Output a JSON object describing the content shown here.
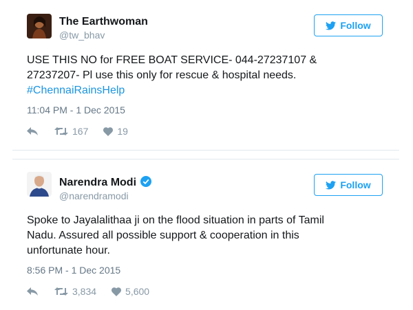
{
  "tweets": [
    {
      "name": "The Earthwoman",
      "handle": "@tw_bhav",
      "verified": false,
      "follow_label": "Follow",
      "text_lines": [
        "USE THIS NO for FREE BOAT SERVICE- 044-27237107 &",
        "27237207- Pl use this only for rescue & hospital needs."
      ],
      "hashtag": "#ChennaiRainsHelp",
      "timestamp": "11:04 PM - 1 Dec 2015",
      "retweets": "167",
      "likes": "19"
    },
    {
      "name": "Narendra Modi",
      "handle": "@narendramodi",
      "verified": true,
      "follow_label": "Follow",
      "text_lines": [
        "Spoke to Jayalalithaa ji on the flood situation in parts of Tamil",
        "Nadu. Assured all possible support & cooperation in this",
        "unfortunate hour."
      ],
      "timestamp": "8:56 PM - 1 Dec 2015",
      "retweets": "3,834",
      "likes": "5,600"
    }
  ],
  "icons": {
    "follow": "twitter-bird-icon",
    "reply": "reply-icon",
    "retweet": "retweet-icon",
    "like": "heart-icon",
    "verified": "verified-badge-icon"
  },
  "colors": {
    "accent": "#1da1f2",
    "hashtag": "#1b95e0",
    "muted": "#8899a6",
    "text": "#14171a"
  }
}
